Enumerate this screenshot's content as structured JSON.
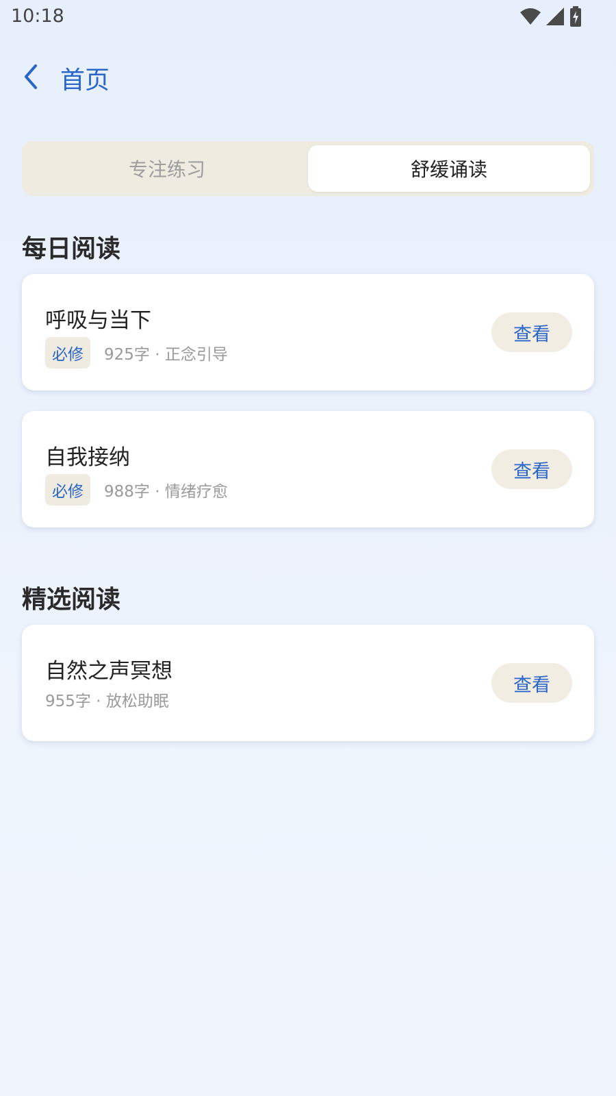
{
  "status_bar": {
    "time": "10:18",
    "icons": [
      "wifi-icon",
      "signal-icon",
      "battery-charging-icon"
    ]
  },
  "nav": {
    "title": "首页"
  },
  "tabs": [
    {
      "label": "专注练习",
      "active": false
    },
    {
      "label": "舒缓诵读",
      "active": true
    }
  ],
  "sections": {
    "daily": {
      "title": "每日阅读",
      "items": [
        {
          "title": "呼吸与当下",
          "badge": "必修",
          "meta": "925字 · 正念引导",
          "action": "查看"
        },
        {
          "title": "自我接纳",
          "badge": "必修",
          "meta": "988字 · 情绪疗愈",
          "action": "查看"
        }
      ]
    },
    "featured": {
      "title": "精选阅读",
      "items": [
        {
          "title": "自然之声冥想",
          "meta": "955字 · 放松助眠",
          "action": "查看"
        }
      ]
    }
  },
  "colors": {
    "accent": "#2a66c8",
    "segment_bg": "#efebe0",
    "card_bg": "#ffffff"
  }
}
